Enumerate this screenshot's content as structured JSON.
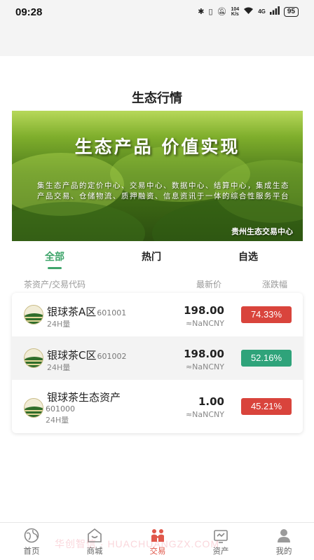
{
  "status": {
    "time": "09:28",
    "net_top": "104",
    "net_bottom": "K/s",
    "signal": "4G",
    "battery": "95"
  },
  "page": {
    "title": "生态行情"
  },
  "banner": {
    "headline": "生态产品  价值实现",
    "subtitle": "集生态产品的定价中心、交易中心、数据中心、结算中心，集成生态产品交易、仓储物流、质押融资、信息资讯于一体的综合性服务平台",
    "brand": "贵州生态交易中心"
  },
  "tabs": [
    {
      "label": "全部",
      "active": true
    },
    {
      "label": "热门",
      "active": false
    },
    {
      "label": "自选",
      "active": false
    }
  ],
  "columns": {
    "asset": "茶资产/交易代码",
    "price": "最新价",
    "change": "涨跌幅"
  },
  "rows": [
    {
      "name": "银球茶A区",
      "code": "601001",
      "volume_label": "24H量",
      "price": "198.00",
      "cny": "≈NaNCNY",
      "change": "74.33%",
      "change_color": "#d9443c"
    },
    {
      "name": "银球茶C区",
      "code": "601002",
      "volume_label": "24H量",
      "price": "198.00",
      "cny": "≈NaNCNY",
      "change": "52.16%",
      "change_color": "#2fa37a"
    },
    {
      "name": "银球茶生态资产",
      "code": "601000",
      "volume_label": "24H量",
      "price": "1.00",
      "cny": "≈NaNCNY",
      "change": "45.21%",
      "change_color": "#d9443c"
    }
  ],
  "nav": [
    {
      "label": "首页",
      "icon": "globe-icon",
      "active": false
    },
    {
      "label": "商城",
      "icon": "store-icon",
      "active": false
    },
    {
      "label": "交易",
      "icon": "trade-icon",
      "active": true
    },
    {
      "label": "资产",
      "icon": "assets-icon",
      "active": false
    },
    {
      "label": "我的",
      "icon": "profile-icon",
      "active": false
    }
  ],
  "watermark": "华创智信 · HUACHUANGZX.COM",
  "colors": {
    "accent": "#3fa56b",
    "up": "#d9443c",
    "down": "#2fa37a",
    "nav_active": "#e0584b"
  }
}
